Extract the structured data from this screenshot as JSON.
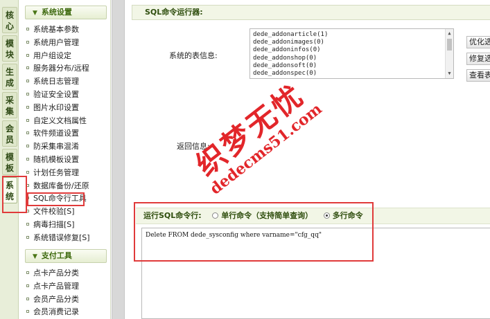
{
  "vtabs": [
    "核心",
    "模块",
    "生成",
    "采集",
    "会员",
    "模板",
    "系统"
  ],
  "menu": {
    "group1_title": "系统设置",
    "group1_items": [
      "系统基本参数",
      "系统用户管理",
      "用户组设定",
      "服务器分布/远程",
      "系统日志管理",
      "验证安全设置",
      "图片水印设置",
      "自定义文档属性",
      "软件频道设置",
      "防采集串混淆",
      "随机模板设置",
      "计划任务管理",
      "数据库备份/还原",
      "SQL命令行工具",
      "文件校验[S]",
      "病毒扫描[S]",
      "系统错误修复[S]"
    ],
    "group2_title": "支付工具",
    "group2_items": [
      "点卡产品分类",
      "点卡产品管理",
      "会员产品分类",
      "会员消费记录"
    ]
  },
  "main": {
    "title": "SQL命令运行器:",
    "tables_label": "系统的表信息:",
    "tables": [
      "dede_addonarticle(1)",
      "dede_addonimages(0)",
      "dede_addoninfos(0)",
      "dede_addonshop(0)",
      "dede_addonsoft(0)",
      "dede_addonspec(0)"
    ],
    "buttons": [
      "优化选",
      "修复选",
      "查看表"
    ],
    "return_label": "返回信息:",
    "run_label": "运行SQL命令行:",
    "option_single": "单行命令（支持简单查询）",
    "option_multi": "多行命令",
    "sql_text": "Delete FROM dede_sysconfig where varname=\"cfg_qq\""
  },
  "watermark": {
    "cn": "织梦无忧",
    "en": "dedecms51.com"
  },
  "colors": {
    "accent_green": "#3e6a0f",
    "annotation_red": "#e03a3a",
    "watermark_red": "#e2262a"
  }
}
